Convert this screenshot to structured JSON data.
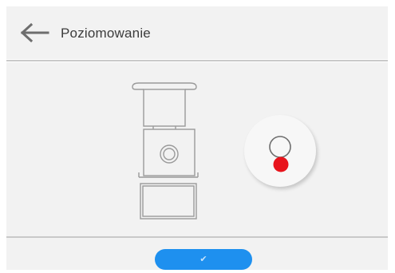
{
  "header": {
    "title": "Poziomowanie",
    "back_icon": "arrow-left-icon"
  },
  "leveling": {
    "bubble_status": "off-level",
    "bubble_color": "#e8141c"
  },
  "footer": {
    "confirm_icon": "check-icon",
    "confirm_glyph": "✔",
    "confirm_color": "#1e90ef"
  },
  "colors": {
    "panel_bg": "#f2f2f2",
    "divider": "#c9c9c9",
    "title_text": "#3c3c3c",
    "icon_gray": "#6e6e6e",
    "illustration_stroke": "#9a9a9a"
  }
}
